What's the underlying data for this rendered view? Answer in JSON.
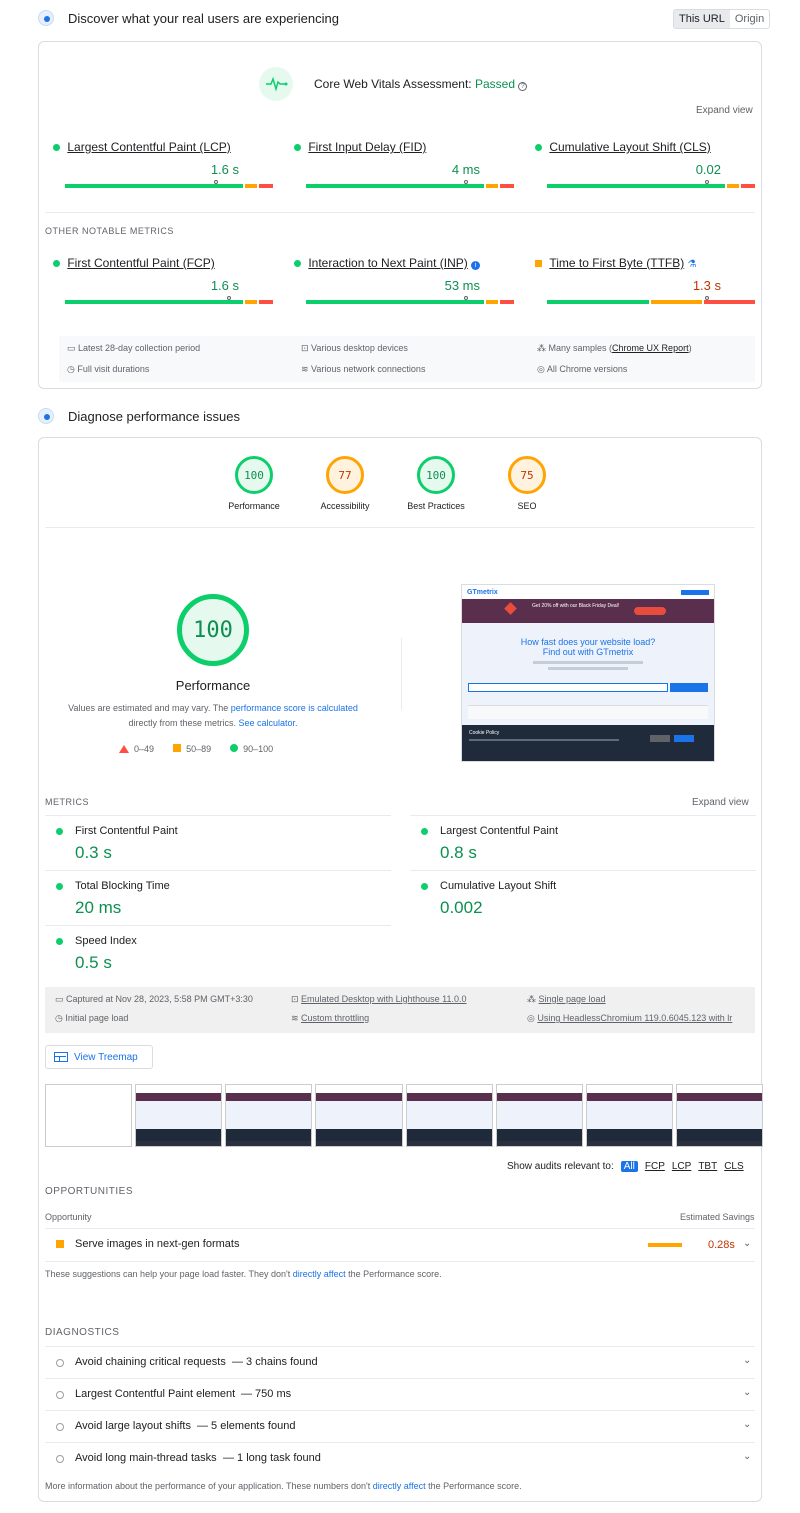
{
  "field": {
    "title": "Discover what your real users are experiencing",
    "toggle": [
      "This URL",
      "Origin"
    ],
    "assessment_label": "Core Web Vitals Assessment:",
    "assessment_status": "Passed",
    "expand": "Expand view",
    "core_metrics": [
      {
        "name": "Largest Contentful Paint (LCP)",
        "value": "1.6 s",
        "status": "good",
        "marker": 0.71
      },
      {
        "name": "First Input Delay (FID)",
        "value": "4 ms",
        "status": "good",
        "marker": 0.75
      },
      {
        "name": "Cumulative Layout Shift (CLS)",
        "value": "0.02",
        "status": "good",
        "marker": 0.75
      }
    ],
    "other_heading": "OTHER NOTABLE METRICS",
    "other_metrics": [
      {
        "name": "First Contentful Paint (FCP)",
        "value": "1.6 s",
        "status": "good",
        "marker": 0.77
      },
      {
        "name": "Interaction to Next Paint (INP)",
        "value": "53 ms",
        "status": "good",
        "marker": 0.75,
        "info": true
      },
      {
        "name": "Time to First Byte (TTFB)",
        "value": "1.3 s",
        "status": "average",
        "marker": 0.75,
        "flask": true
      }
    ],
    "footer": [
      [
        "Latest 28-day collection period",
        "Various desktop devices",
        "Many samples (",
        "Chrome UX Report",
        ")"
      ],
      [
        "Full visit durations",
        "Various network connections",
        "All Chrome versions"
      ]
    ]
  },
  "lab": {
    "title": "Diagnose performance issues",
    "categories": [
      {
        "label": "Performance",
        "score": "100",
        "rating": "good"
      },
      {
        "label": "Accessibility",
        "score": "77",
        "rating": "average"
      },
      {
        "label": "Best Practices",
        "score": "100",
        "rating": "good"
      },
      {
        "label": "SEO",
        "score": "75",
        "rating": "average"
      }
    ],
    "big_score": "100",
    "big_label": "Performance",
    "note_1": "Values are estimated and may vary. The",
    "note_link_1": "performance score is calculated",
    "note_2": "directly from these metrics.",
    "note_link_2": "See calculator.",
    "legend": [
      "0–49",
      "50–89",
      "90–100"
    ],
    "screenshot": {
      "logo": "GTmetrix",
      "banner": "Get 20% off with our Black Friday Deal!",
      "headline_1": "How fast does your website load?",
      "headline_2": "Find out with GTmetrix",
      "cookie": "Cookie Policy"
    },
    "metrics_heading": "METRICS",
    "metrics_expand": "Expand view",
    "metrics": [
      {
        "label": "First Contentful Paint",
        "value": "0.3 s"
      },
      {
        "label": "Largest Contentful Paint",
        "value": "0.8 s"
      },
      {
        "label": "Total Blocking Time",
        "value": "20 ms"
      },
      {
        "label": "Cumulative Layout Shift",
        "value": "0.002"
      },
      {
        "label": "Speed Index",
        "value": "0.5 s"
      }
    ],
    "run_info": [
      [
        "Captured at Nov 28, 2023, 5:58 PM GMT+3:30",
        "Emulated Desktop with Lighthouse 11.0.0",
        "Single page load"
      ],
      [
        "Initial page load",
        "Custom throttling",
        "Using HeadlessChromium 119.0.6045.123 with lr"
      ]
    ],
    "treemap": "View Treemap",
    "audits_filter_label": "Show audits relevant to:",
    "audits_filter": [
      "All",
      "FCP",
      "LCP",
      "TBT",
      "CLS"
    ],
    "opportunities_heading": "OPPORTUNITIES",
    "opp_col_1": "Opportunity",
    "opp_col_2": "Estimated Savings",
    "opportunities": [
      {
        "title": "Serve images in next-gen formats",
        "savings": "0.28s"
      }
    ],
    "opp_note_1": "These suggestions can help your page load faster. They don't",
    "opp_note_link": "directly affect",
    "opp_note_2": "the Performance score.",
    "diagnostics_heading": "DIAGNOSTICS",
    "diagnostics": [
      {
        "title": "Avoid chaining critical requests",
        "detail": "— 3 chains found"
      },
      {
        "title": "Largest Contentful Paint element",
        "detail": "— 750 ms"
      },
      {
        "title": "Avoid large layout shifts",
        "detail": "— 5 elements found"
      },
      {
        "title": "Avoid long main-thread tasks",
        "detail": "— 1 long task found"
      }
    ],
    "diag_note_1": "More information about the performance of your application. These numbers don't",
    "diag_note_link": "directly affect",
    "diag_note_2": "the Performance score."
  },
  "colors": {
    "good": "#0cce6b",
    "average": "#ffa400",
    "poor": "#ff4e42",
    "link": "#1a73e8"
  }
}
